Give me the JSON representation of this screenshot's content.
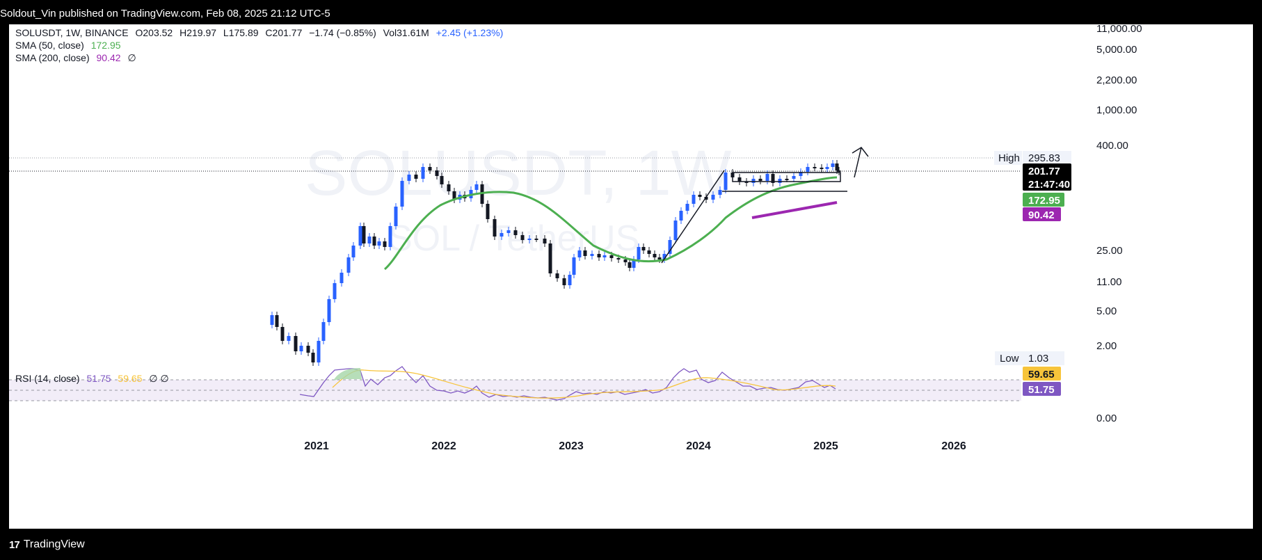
{
  "topbar": {
    "text": "Soldout_Vin published on TradingView.com, Feb 08, 2025 21:12 UTC-5"
  },
  "legend": {
    "symbol": "SOLUSDT, 1W, BINANCE",
    "open": "O203.52",
    "high": "H219.97",
    "low": "L175.89",
    "close": "C201.77",
    "change": "−1.74 (−0.85%)",
    "vol_label": "Vol",
    "vol": "31.61M",
    "vol_change": "+2.45 (+1.23%)",
    "sma50_label": "SMA (50, close)",
    "sma50_value": "172.95",
    "sma200_label": "SMA (200, close)",
    "sma200_value": "90.42",
    "sma200_extra": "∅",
    "rsi_label": "RSI (14, close)",
    "rsi_value": "51.75",
    "rsi_ma": "59.65",
    "rsi_extra": "∅ ∅"
  },
  "watermark": {
    "line1": "SOLUSDT, 1W",
    "line2": "SOL / TetherUS"
  },
  "price_axis": [
    "11,000.00",
    "5,000.00",
    "2,200.00",
    "1,000.00",
    "400.00",
    "25.00",
    "11.00",
    "5.00",
    "2.00",
    "0.00"
  ],
  "time_axis": [
    "2021",
    "2022",
    "2023",
    "2024",
    "2025",
    "2026"
  ],
  "tags": {
    "high_label": "High",
    "high_value": "295.83",
    "last_price": "201.77",
    "countdown": "21:47:40",
    "sma50": "172.95",
    "sma200": "90.42",
    "low_label": "Low",
    "low_value": "1.03",
    "rsi_ma": "59.65",
    "rsi": "51.75"
  },
  "colors": {
    "up": "#2962ff",
    "down": "#131722",
    "sma50": "#4caf50",
    "sma200": "#9c27b0",
    "rsi": "#7e57c2",
    "rsi_ma": "#f7c43a",
    "text": "#131722"
  },
  "chart_data": {
    "type": "candlestick",
    "symbol": "SOLUSDT",
    "interval": "1W",
    "exchange": "BINANCE",
    "scale": "log",
    "last": {
      "open": 203.52,
      "high": 219.97,
      "low": 175.89,
      "close": 201.77,
      "change": -1.74,
      "change_pct": -0.85
    },
    "x_ticks": [
      "2021",
      "2022",
      "2023",
      "2024",
      "2025",
      "2026"
    ],
    "y_ticks": [
      0,
      2,
      5,
      11,
      25,
      400,
      1000,
      2200,
      5000,
      11000
    ],
    "close_series": [
      {
        "x": "2020-08",
        "y": 3.5
      },
      {
        "x": "2020-10",
        "y": 2.2
      },
      {
        "x": "2020-12",
        "y": 1.6
      },
      {
        "x": "2021-02",
        "y": 12
      },
      {
        "x": "2021-04",
        "y": 30
      },
      {
        "x": "2021-06",
        "y": 33
      },
      {
        "x": "2021-08",
        "y": 70
      },
      {
        "x": "2021-10",
        "y": 190
      },
      {
        "x": "2021-11",
        "y": 250
      },
      {
        "x": "2021-12",
        "y": 175
      },
      {
        "x": "2022-02",
        "y": 95
      },
      {
        "x": "2022-04",
        "y": 110
      },
      {
        "x": "2022-05",
        "y": 50
      },
      {
        "x": "2022-07",
        "y": 40
      },
      {
        "x": "2022-10",
        "y": 32
      },
      {
        "x": "2022-11",
        "y": 13
      },
      {
        "x": "2022-12",
        "y": 10
      },
      {
        "x": "2023-01",
        "y": 22
      },
      {
        "x": "2023-04",
        "y": 21
      },
      {
        "x": "2023-06",
        "y": 16
      },
      {
        "x": "2023-08",
        "y": 24
      },
      {
        "x": "2023-10",
        "y": 30
      },
      {
        "x": "2023-12",
        "y": 100
      },
      {
        "x": "2024-03",
        "y": 190
      },
      {
        "x": "2024-06",
        "y": 150
      },
      {
        "x": "2024-09",
        "y": 140
      },
      {
        "x": "2024-11",
        "y": 240
      },
      {
        "x": "2025-01",
        "y": 250
      },
      {
        "x": "2025-02",
        "y": 201.77
      }
    ],
    "series": [
      {
        "name": "SMA (50, close)",
        "last": 172.95
      },
      {
        "name": "SMA (200, close)",
        "last": 90.42
      },
      {
        "name": "RSI (14, close)",
        "last": 51.75,
        "ma": 59.65
      }
    ],
    "annotations": [
      "High 295.83",
      "Low 1.03"
    ]
  }
}
